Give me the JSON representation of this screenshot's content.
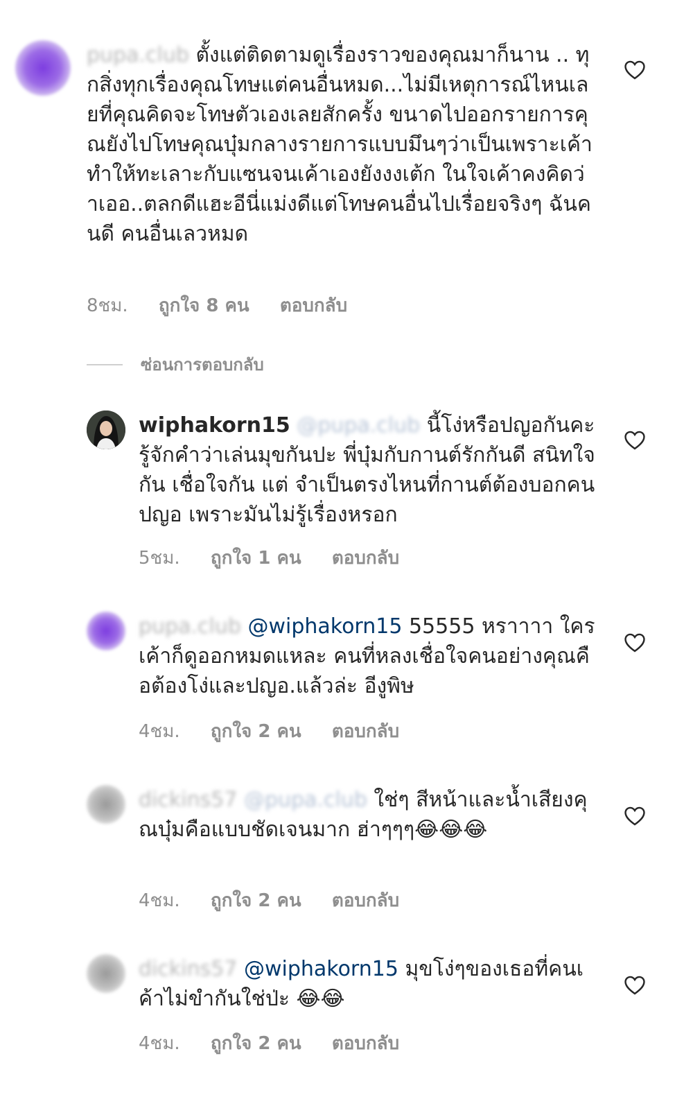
{
  "comments": [
    {
      "username": "pupa.club",
      "mention": "",
      "text": "ตั้งแต่ติดตามดูเรื่องราวของคุณมาก็นาน .. ทุกสิ่งทุกเรื่องคุณโทษแต่คนอื่นหมด...ไม่มีเหตุการณ์ไหนเลยที่คุณคิดจะโทษตัวเองเลยสักครั้ง ขนาดไปออกรายการคุณยังไปโทษคุณบุ๋มกลางรายการแบบมึนๆว่าเป็นเพราะเค้าทำให้ทะเลาะกับแซนจนเค้าเองยังงงเต้ก ในใจเค้าคงคิดว่าเออ..ตลกดีแฮะอีนี่แม่งดีแต่โทษคนอื่นไปเรื่อยจริงๆ ฉันคนดี คนอื่นเลวหมด",
      "time": "8ชม.",
      "likes": "ถูกใจ 8 คน",
      "reply": "ตอบกลับ"
    },
    {
      "username": "wiphakorn15",
      "mention": "@pupa.club",
      "text": "นี้โง่หรือปญอกันคะ รู้จักคำว่าเล่นมุขกันปะ พี่บุ๋มกับกานต์รักกันดี สนิทใจกัน เชื่อใจกัน แต่ จำเป็นตรงไหนที่กานต์ต้องบอกคนปญอ เพราะมันไม่รู้เรื่องหรอก",
      "time": "5ชม.",
      "likes": "ถูกใจ 1 คน",
      "reply": "ตอบกลับ"
    },
    {
      "username": "pupa.club",
      "mention": "@wiphakorn15",
      "text": "55555 หราาาา ใครเค้าก็ดูออกหมดแหละ  คนที่หลงเชื่อใจคนอย่างคุณคือต้องโง่และปญอ.แล้วล่ะ อีงูพิษ",
      "time": "4ชม.",
      "likes": "ถูกใจ 2 คน",
      "reply": "ตอบกลับ"
    },
    {
      "username": "dickins57",
      "mention": "@pupa.club",
      "text": "ใช่ๆ  สีหน้าและน้ำเสียงคุณบุ๋มคือแบบชัดเจนมาก ฮ่าๆๆๆ😂😂😂",
      "time": "4ชม.",
      "likes": "ถูกใจ 2 คน",
      "reply": "ตอบกลับ"
    },
    {
      "username": "dickins57",
      "mention": "@wiphakorn15",
      "text": "มุขโง่ๆของเธอที่คนเค้าไม่ขำกันใช่ป่ะ 😂😂",
      "time": "4ชม.",
      "likes": "ถูกใจ 2 คน",
      "reply": "ตอบกลับ"
    }
  ],
  "hide_replies": "ซ่อนการตอบกลับ",
  "icons": {
    "like": "heart-outline-icon"
  },
  "colors": {
    "text": "#262626",
    "muted": "#8e8e8e",
    "mention": "#00376b"
  }
}
